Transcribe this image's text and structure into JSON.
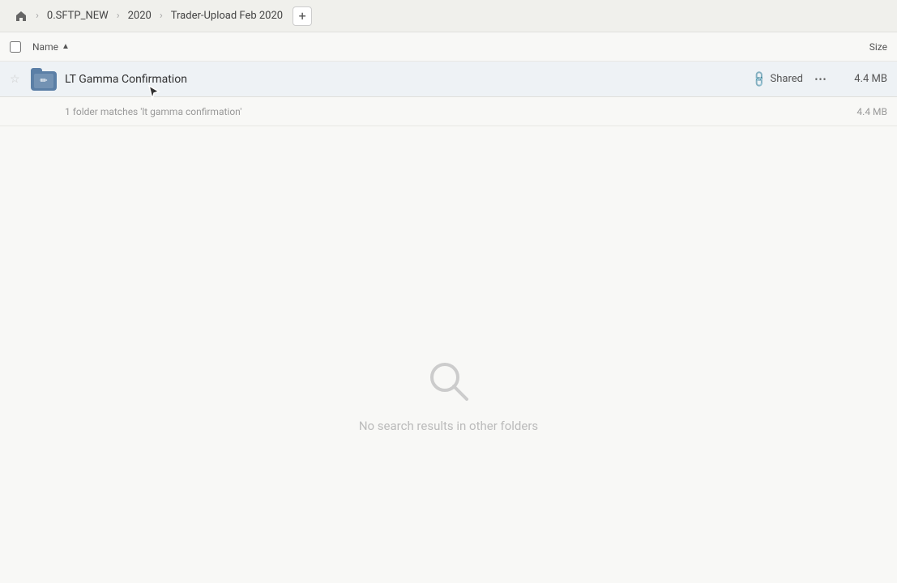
{
  "breadcrumb": {
    "home_icon": "🏠",
    "items": [
      "0.SFTP_NEW",
      "2020",
      "Trader-Upload Feb 2020"
    ],
    "add_label": "+"
  },
  "columns": {
    "name_label": "Name",
    "size_label": "Size"
  },
  "file_row": {
    "folder_name": "LT Gamma Confirmation",
    "shared_label": "Shared",
    "more_icon": "•••",
    "size": "4.4 MB"
  },
  "summary": {
    "text": "1 folder matches 'lt gamma confirmation'",
    "size": "4.4 MB"
  },
  "empty_state": {
    "message": "No search results in other folders"
  }
}
